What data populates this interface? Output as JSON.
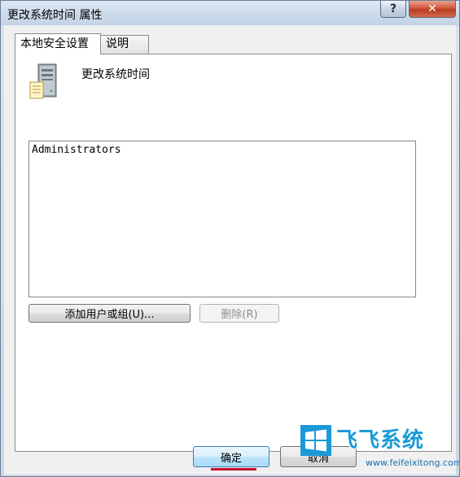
{
  "window": {
    "title": "更改系统时间 属性",
    "help_label": "?",
    "close_label": "✕"
  },
  "tabs": [
    {
      "label": "本地安全设置",
      "active": true
    },
    {
      "label": "说明",
      "active": false
    }
  ],
  "policy": {
    "name": "更改系统时间",
    "icon": "server-policy-icon"
  },
  "userlist": {
    "items": [
      "Administrators"
    ]
  },
  "buttons": {
    "add": "添加用户或组(U)...",
    "remove": "删除(R)",
    "ok": "确定",
    "cancel": "取消"
  },
  "watermark": {
    "title": "飞飞系统",
    "url": "www.feifeixitong.com"
  },
  "colors": {
    "accent": "#3c7fb1",
    "close": "#c7452a",
    "underline": "#c8102e",
    "watermark": "#1a9ad8"
  }
}
